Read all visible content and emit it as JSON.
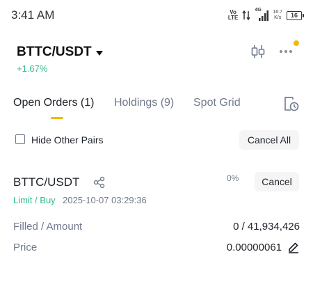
{
  "status_bar": {
    "time": "3:41 AM",
    "volte": [
      "Vo",
      "LTE"
    ],
    "net_gen": "4G",
    "net_speed_value": "16.7",
    "net_speed_unit": "K/s",
    "battery": "16"
  },
  "header": {
    "pair": "BTTC/USDT",
    "change": "+1.67%",
    "colors": {
      "positive": "#2ebd85",
      "accent": "#f0b90b"
    },
    "icons": [
      "candlestick-chart-icon",
      "more-dots-icon"
    ]
  },
  "tabs": [
    {
      "label": "Open Orders (1)",
      "active": true
    },
    {
      "label": "Holdings (9)",
      "active": false
    },
    {
      "label": "Spot Grid",
      "active": false
    }
  ],
  "filter": {
    "hide_other_pairs_label": "Hide Other Pairs",
    "hide_other_pairs_checked": false,
    "cancel_all_label": "Cancel All"
  },
  "order": {
    "pair": "BTTC/USDT",
    "type": "Limit / Buy",
    "time": "2025-10-07 03:29:36",
    "progress": "0%",
    "cancel_label": "Cancel",
    "filled_label": "Filled / Amount",
    "filled_value": "0 / 41,934,426",
    "price_label": "Price",
    "price_value": "0.00000061"
  }
}
